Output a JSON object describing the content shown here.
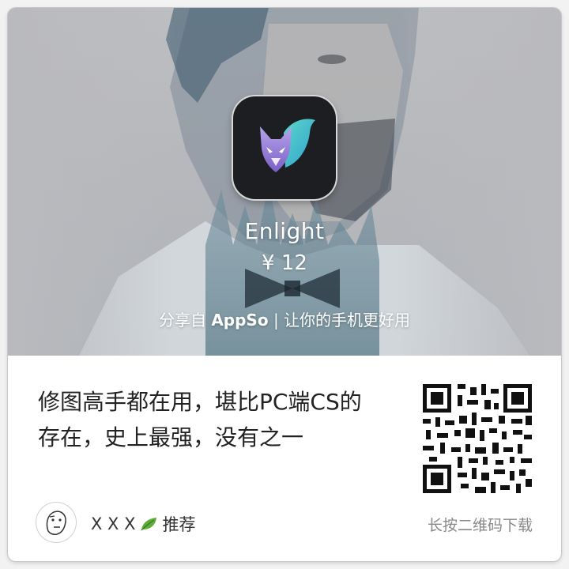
{
  "app": {
    "name": "Enlight",
    "price": "¥ 12",
    "icon": "fox-logo-icon"
  },
  "share": {
    "prefix": "分享自",
    "brand": "AppSo",
    "suffix": "| 让你的手机更好用"
  },
  "description": {
    "line1": "修图高手都在用，堪比PC端CS的",
    "line2": "存在，史上最强，没有之一"
  },
  "footer": {
    "user_name": "X X X",
    "leaf_icon": "leaf-icon",
    "recommend_label": "推荐",
    "qr_hint": "长按二维码下载"
  },
  "colors": {
    "hero_gray": "#b8b9bd",
    "icon_bg": "#1d1e22",
    "text_dark": "#222222",
    "text_muted": "#888888"
  }
}
